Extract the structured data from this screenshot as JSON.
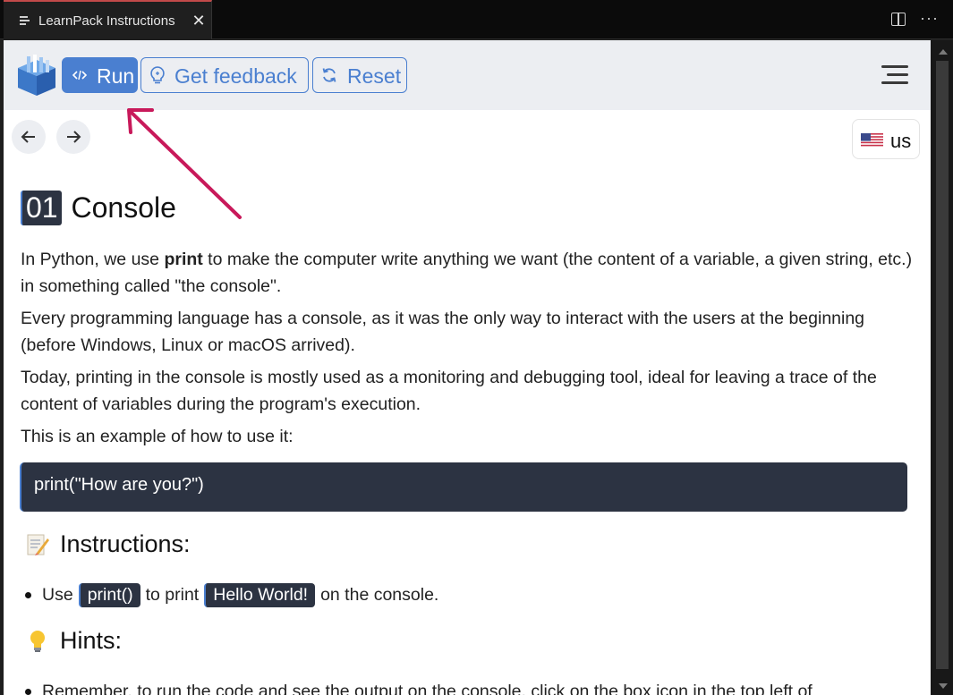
{
  "tab": {
    "title": "LearnPack Instructions",
    "close": "✕"
  },
  "window_actions": {
    "more": "···"
  },
  "toolbar": {
    "run_label": "Run",
    "feedback_label": "Get feedback",
    "reset_label": "Reset"
  },
  "language": {
    "label": "us"
  },
  "lesson": {
    "number": "01",
    "title": "Console",
    "paragraphs": [
      {
        "before": "In Python, we use ",
        "bold": "print",
        "after": " to make the computer write anything we want (the content of a variable, a given string, etc.) in something called \"the console\"."
      },
      {
        "text": "Every programming language has a console, as it was the only way to interact with the users at the beginning (before Windows, Linux or macOS arrived)."
      },
      {
        "text": "Today, printing in the console is mostly used as a monitoring and debugging tool, ideal for leaving a trace of the content of variables during the program's execution."
      },
      {
        "text": "This is an example of how to use it:"
      }
    ],
    "code_example": "print(\"How are you?\")",
    "instructions_heading": "Instructions:",
    "instruction_item": {
      "prefix": "Use",
      "code1": "print()",
      "middle": "to print",
      "code2": "Hello World!",
      "suffix": "on the console."
    },
    "hints_heading": "Hints:",
    "hint_item": "Remember, to run the code and see the output on the console, click on the box icon in the top left of"
  },
  "colors": {
    "accent": "#4a7fd0",
    "code_bg": "#2c3342",
    "annotation_arrow": "#c8195a",
    "tab_border": "#c24a4a"
  },
  "icons": {
    "tab": "document-lines-icon",
    "logo": "learnpack-box-logo",
    "run": "code-brackets-icon",
    "feedback": "lightbulb-icon",
    "reset": "refresh-icon",
    "menu": "hamburger-menu-icon",
    "prev": "arrow-left-icon",
    "next": "arrow-right-icon",
    "flag": "us-flag-icon"
  }
}
